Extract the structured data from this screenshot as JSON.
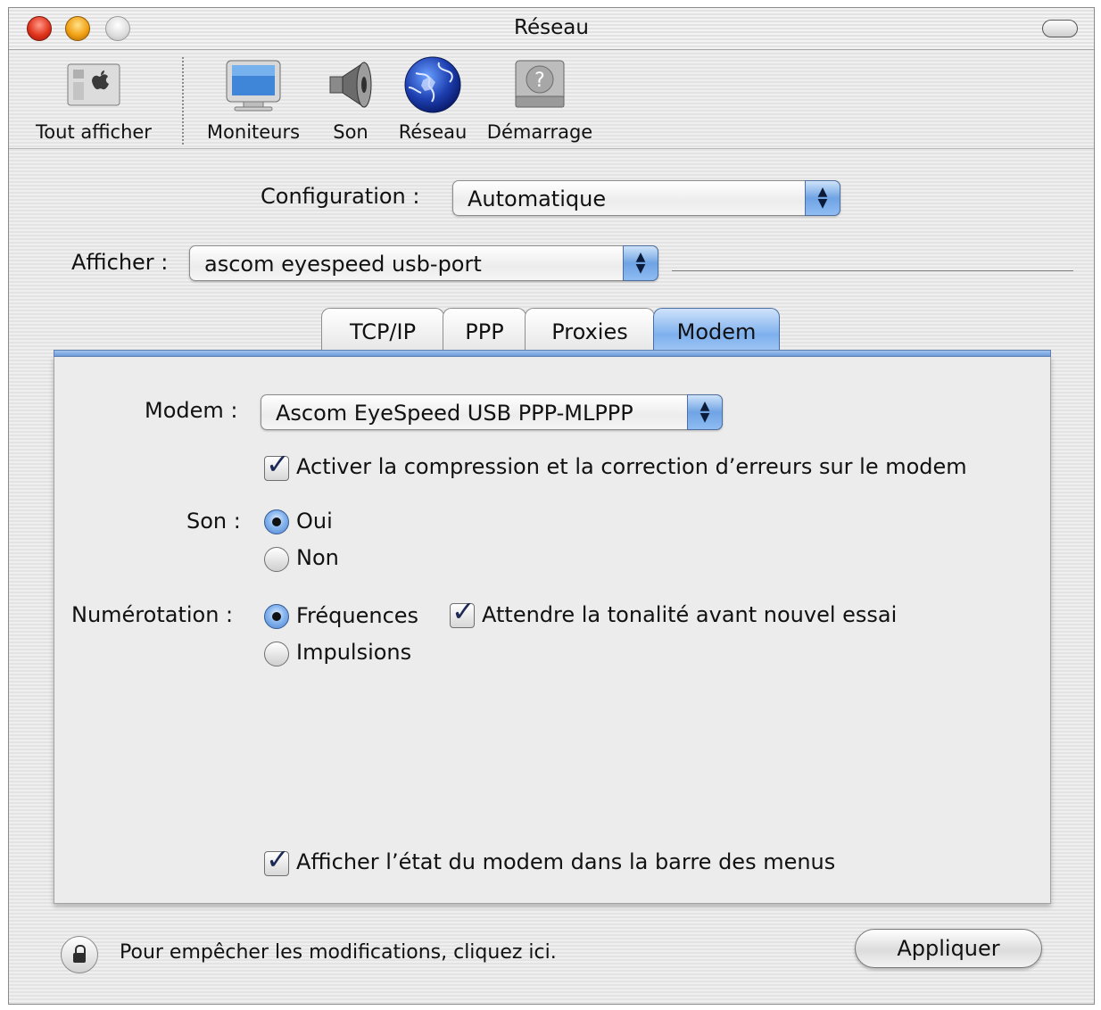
{
  "window": {
    "title": "Réseau"
  },
  "toolbar": {
    "items": [
      {
        "label": "Tout afficher",
        "icon": "show-all-icon"
      },
      {
        "label": "Moniteurs",
        "icon": "monitor-icon"
      },
      {
        "label": "Son",
        "icon": "speaker-icon"
      },
      {
        "label": "Réseau",
        "icon": "globe-icon"
      },
      {
        "label": "Démarrage",
        "icon": "startup-disk-icon"
      }
    ]
  },
  "configuration": {
    "label": "Configuration :",
    "value": "Automatique"
  },
  "show": {
    "label": "Afficher :",
    "value": "ascom eyespeed usb-port"
  },
  "tabs": [
    {
      "label": "TCP/IP",
      "active": false
    },
    {
      "label": "PPP",
      "active": false
    },
    {
      "label": "Proxies",
      "active": false
    },
    {
      "label": "Modem",
      "active": true
    }
  ],
  "modem_panel": {
    "modem_label": "Modem :",
    "modem_value": "Ascom EyeSpeed USB PPP-MLPPP",
    "compression_checkbox": {
      "label": "Activer la compression et la correction d’erreurs sur le modem",
      "checked": true
    },
    "sound": {
      "label": "Son :",
      "options": [
        {
          "label": "Oui",
          "selected": true
        },
        {
          "label": "Non",
          "selected": false
        }
      ]
    },
    "dialing": {
      "label": "Numérotation :",
      "options": [
        {
          "label": "Fréquences",
          "selected": true
        },
        {
          "label": "Impulsions",
          "selected": false
        }
      ],
      "wait_tone_checkbox": {
        "label": "Attendre la tonalité avant nouvel essai",
        "checked": true
      }
    },
    "menu_status_checkbox": {
      "label": "Afficher l’état du modem dans la barre des menus",
      "checked": true
    }
  },
  "footer": {
    "lock_text": "Pour empêcher les modifications, cliquez ici.",
    "apply_label": "Appliquer"
  },
  "colors": {
    "accent_blue": "#6fa3e4",
    "traffic_red": "#e0341c",
    "traffic_yellow": "#f2a114"
  }
}
